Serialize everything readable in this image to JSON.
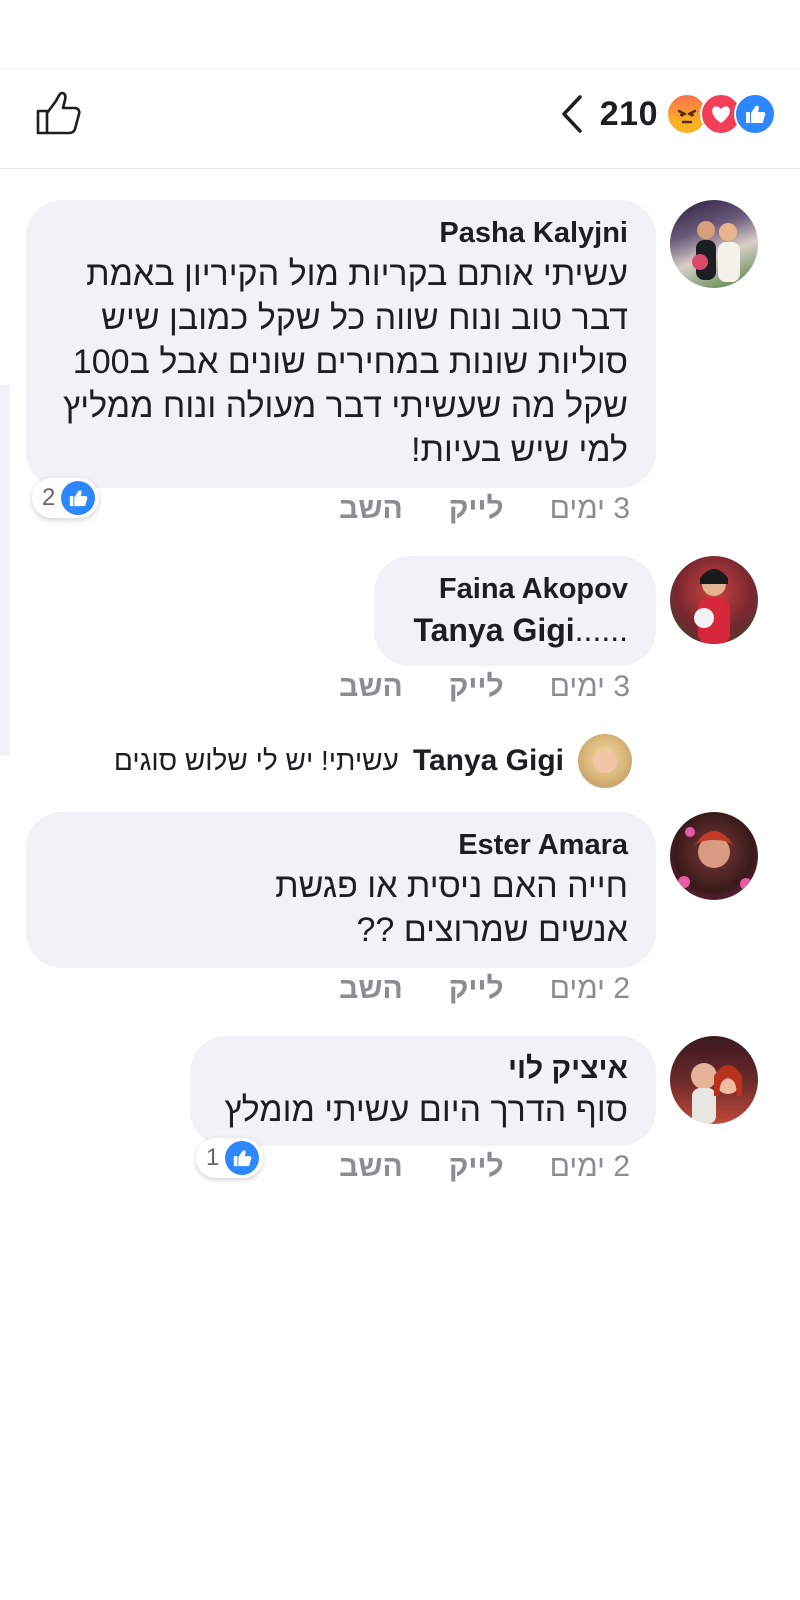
{
  "header": {
    "reaction_count": "210",
    "reaction_icons": [
      "angry-icon",
      "love-icon",
      "like-icon"
    ],
    "accent_color": "#2d88ff"
  },
  "comments": [
    {
      "author": "Pasha  Kalyjni",
      "text": "עשיתי אותם בקריות מול הקיריון באמת דבר טוב ונוח שווה כל שקל כמובן שיש סוליות שונות במחירים שונים אבל ב100 שקל מה שעשיתי דבר מעולה ונוח ממליץ למי שיש בעיות!",
      "likes": "2",
      "time": "3 ימים",
      "like_label": "לייק",
      "reply_label": "השב"
    },
    {
      "author": "Faina Akopov",
      "mention": "Tanya Gigi",
      "text_suffix": "......",
      "time": "3 ימים",
      "like_label": "לייק",
      "reply_label": "השב"
    },
    {
      "author": "Ester Amara",
      "text": "חייה האם ניסית או פגשת אנשים שמרוצים ??",
      "time": "2 ימים",
      "like_label": "לייק",
      "reply_label": "השב"
    },
    {
      "author": "איציק לוי",
      "text": "סוף הדרך היום עשיתי מומלץ",
      "likes": "1",
      "time": "2 ימים",
      "like_label": "לייק",
      "reply_label": "השב"
    }
  ],
  "reply_preview": {
    "author": "Tanya Gigi",
    "text": "עשיתי!  יש לי שלוש סוגים"
  }
}
